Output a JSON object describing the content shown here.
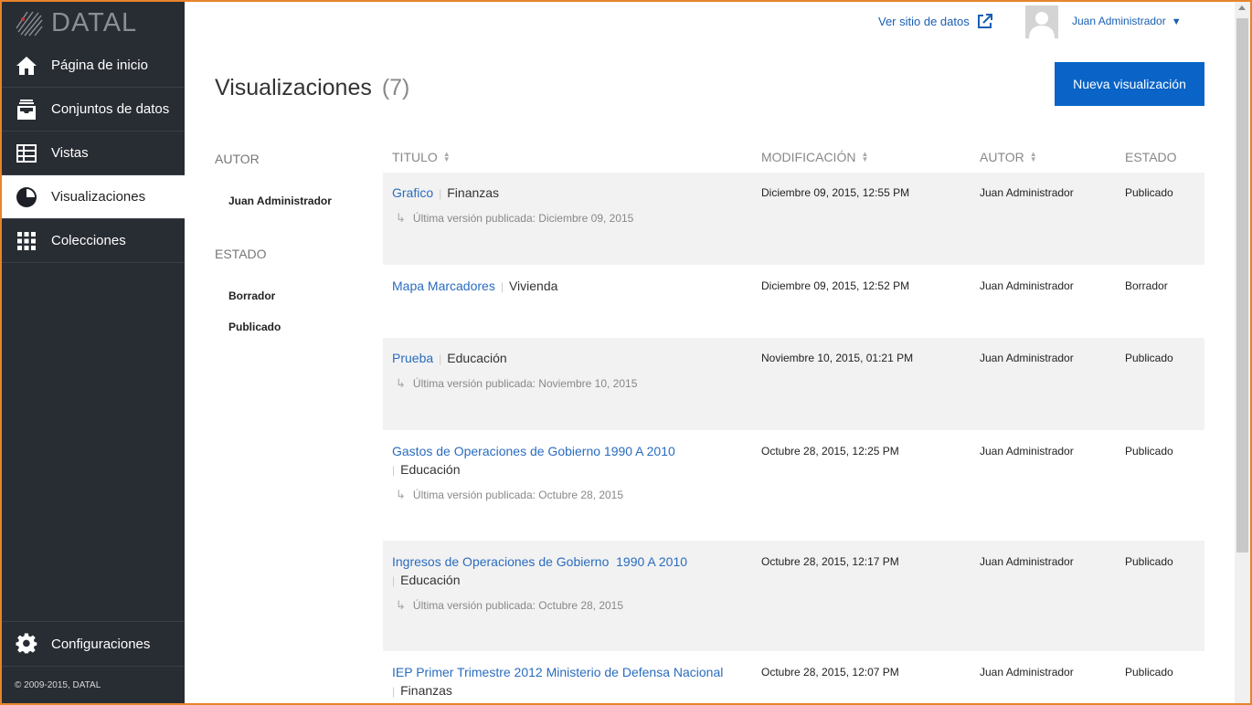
{
  "app": {
    "logo_text": "DATAL",
    "copyright": "© 2009-2015, DATAL"
  },
  "sidebar": {
    "items": [
      {
        "label": "Página de inicio",
        "icon": "home-icon"
      },
      {
        "label": "Conjuntos de datos",
        "icon": "inbox-icon"
      },
      {
        "label": "Vistas",
        "icon": "table-icon"
      },
      {
        "label": "Visualizaciones",
        "icon": "pie-chart-icon",
        "active": true
      },
      {
        "label": "Colecciones",
        "icon": "grid-icon"
      }
    ],
    "settings_label": "Configuraciones"
  },
  "topbar": {
    "external_link": "Ver sitio de datos",
    "user_name": "Juan Administrador",
    "caret": "▼"
  },
  "page": {
    "title": "Visualizaciones",
    "count": "(7)",
    "new_button": "Nueva visualización"
  },
  "filters": {
    "author_heading": "AUTOR",
    "author_items": [
      "Juan Administrador"
    ],
    "state_heading": "ESTADO",
    "state_items": [
      "Borrador",
      "Publicado"
    ]
  },
  "table": {
    "columns": [
      "TITULO",
      "MODIFICACIÓN",
      "AUTOR",
      "ESTADO"
    ],
    "rows": [
      {
        "title": "Grafico",
        "category": "Finanzas",
        "version": "Última versión publicada: Diciembre 09, 2015",
        "modified": "Diciembre 09, 2015, 12:55 PM",
        "author": "Juan Administrador",
        "state": "Publicado"
      },
      {
        "title": "Mapa Marcadores",
        "category": "Vivienda",
        "version": "",
        "modified": "Diciembre 09, 2015, 12:52 PM",
        "author": "Juan Administrador",
        "state": "Borrador"
      },
      {
        "title": "Prueba",
        "category": "Educación",
        "version": "Última versión publicada: Noviembre 10, 2015",
        "modified": "Noviembre 10, 2015, 01:21 PM",
        "author": "Juan Administrador",
        "state": "Publicado"
      },
      {
        "title": "Gastos de Operaciones de Gobierno 1990 A 2010",
        "category": "Educación",
        "version": "Última versión publicada: Octubre 28, 2015",
        "modified": "Octubre 28, 2015, 12:25 PM",
        "author": "Juan Administrador",
        "state": "Publicado"
      },
      {
        "title": "Ingresos de Operaciones de Gobierno  1990 A 2010",
        "category": "Educación",
        "version": "Última versión publicada: Octubre 28, 2015",
        "modified": "Octubre 28, 2015, 12:17 PM",
        "author": "Juan Administrador",
        "state": "Publicado"
      },
      {
        "title": "IEP Primer Trimestre 2012 Ministerio de Defensa Nacional",
        "category": "Finanzas",
        "version": "",
        "modified": "Octubre 28, 2015, 12:07 PM",
        "author": "Juan Administrador",
        "state": "Publicado"
      }
    ]
  },
  "colors": {
    "sidebar_bg": "#282c33",
    "accent": "#0a64c7",
    "link": "#2a6cbf",
    "frame": "#e8842c"
  }
}
